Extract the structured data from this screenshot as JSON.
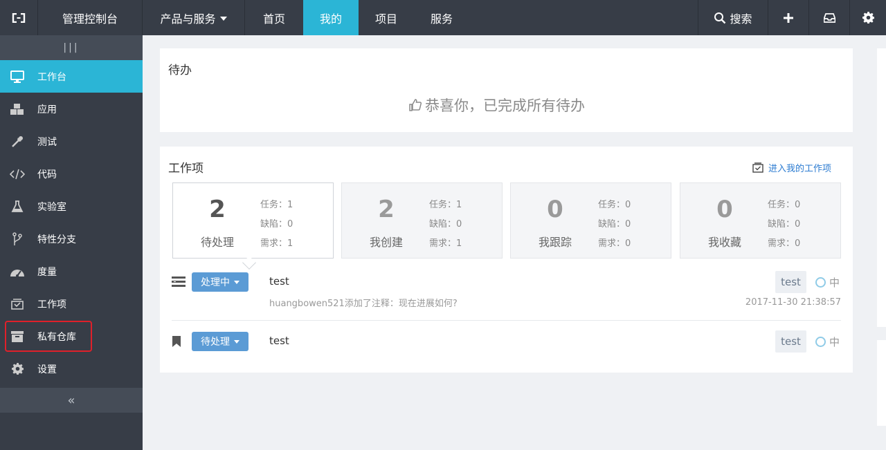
{
  "topbar": {
    "title": "管理控制台",
    "products_label": "产品与服务",
    "nav": [
      "首页",
      "我的",
      "项目",
      "服务"
    ],
    "search_label": "搜索",
    "active_color": "#2bb5d6"
  },
  "sidebar": {
    "grip": "|||",
    "items": [
      {
        "label": "工作台",
        "icon": "monitor-icon"
      },
      {
        "label": "应用",
        "icon": "cubes-icon"
      },
      {
        "label": "测试",
        "icon": "pipette-icon"
      },
      {
        "label": "代码",
        "icon": "code-icon"
      },
      {
        "label": "实验室",
        "icon": "flask-icon"
      },
      {
        "label": "特性分支",
        "icon": "branch-icon"
      },
      {
        "label": "度量",
        "icon": "gauge-icon"
      },
      {
        "label": "工作项",
        "icon": "tray-icon"
      },
      {
        "label": "私有仓库",
        "icon": "archive-icon"
      },
      {
        "label": "设置",
        "icon": "gear-icon"
      }
    ],
    "collapse": "«"
  },
  "todo": {
    "title": "待办",
    "done_message": "恭喜你，已完成所有待办"
  },
  "work": {
    "title": "工作项",
    "link": "进入我的工作项",
    "cards": [
      {
        "count": "2",
        "label": "待处理",
        "stats": [
          "任务：1",
          "缺陷：0",
          "需求：1"
        ]
      },
      {
        "count": "2",
        "label": "我创建",
        "stats": [
          "任务：1",
          "缺陷：0",
          "需求：1"
        ]
      },
      {
        "count": "0",
        "label": "我跟踪",
        "stats": [
          "任务：0",
          "缺陷：0",
          "需求：0"
        ]
      },
      {
        "count": "0",
        "label": "我收藏",
        "stats": [
          "任务：0",
          "缺陷：0",
          "需求：0"
        ]
      }
    ],
    "rows": [
      {
        "status": "处理中",
        "title": "test",
        "note": "huangbowen521添加了注释：现在进展如何?",
        "tag": "test",
        "priority": "中",
        "time": "2017-11-30 21:38:57"
      },
      {
        "status": "待处理",
        "title": "test",
        "tag": "test",
        "priority": "中"
      }
    ]
  }
}
